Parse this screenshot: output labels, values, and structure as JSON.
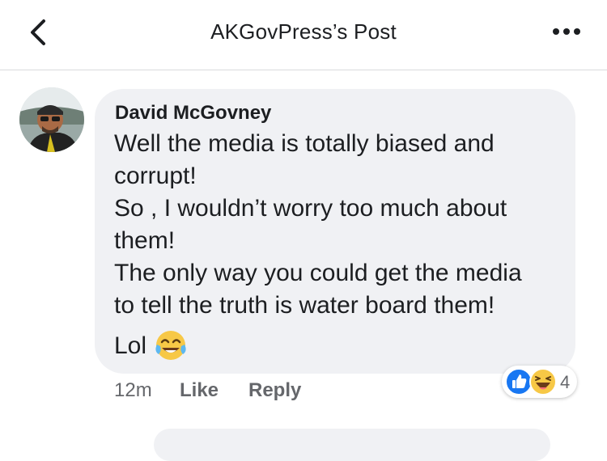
{
  "header": {
    "title": "AKGovPress’s Post"
  },
  "comment": {
    "author": "David McGovney",
    "lines": [
      "Well the media is totally biased and",
      "corrupt!",
      "So , I wouldn’t worry too much about",
      "them!",
      "The only way you could get the media",
      "to tell the truth is water board them!",
      "Lol"
    ],
    "timestamp": "12m",
    "like_label": "Like",
    "reply_label": "Reply",
    "reaction_count": "4",
    "reactions": [
      "like-icon",
      "haha-icon"
    ]
  },
  "colors": {
    "like_blue": "#1877f2",
    "bubble_bg": "#f0f1f4",
    "haha_yellow": "#f7c846"
  }
}
